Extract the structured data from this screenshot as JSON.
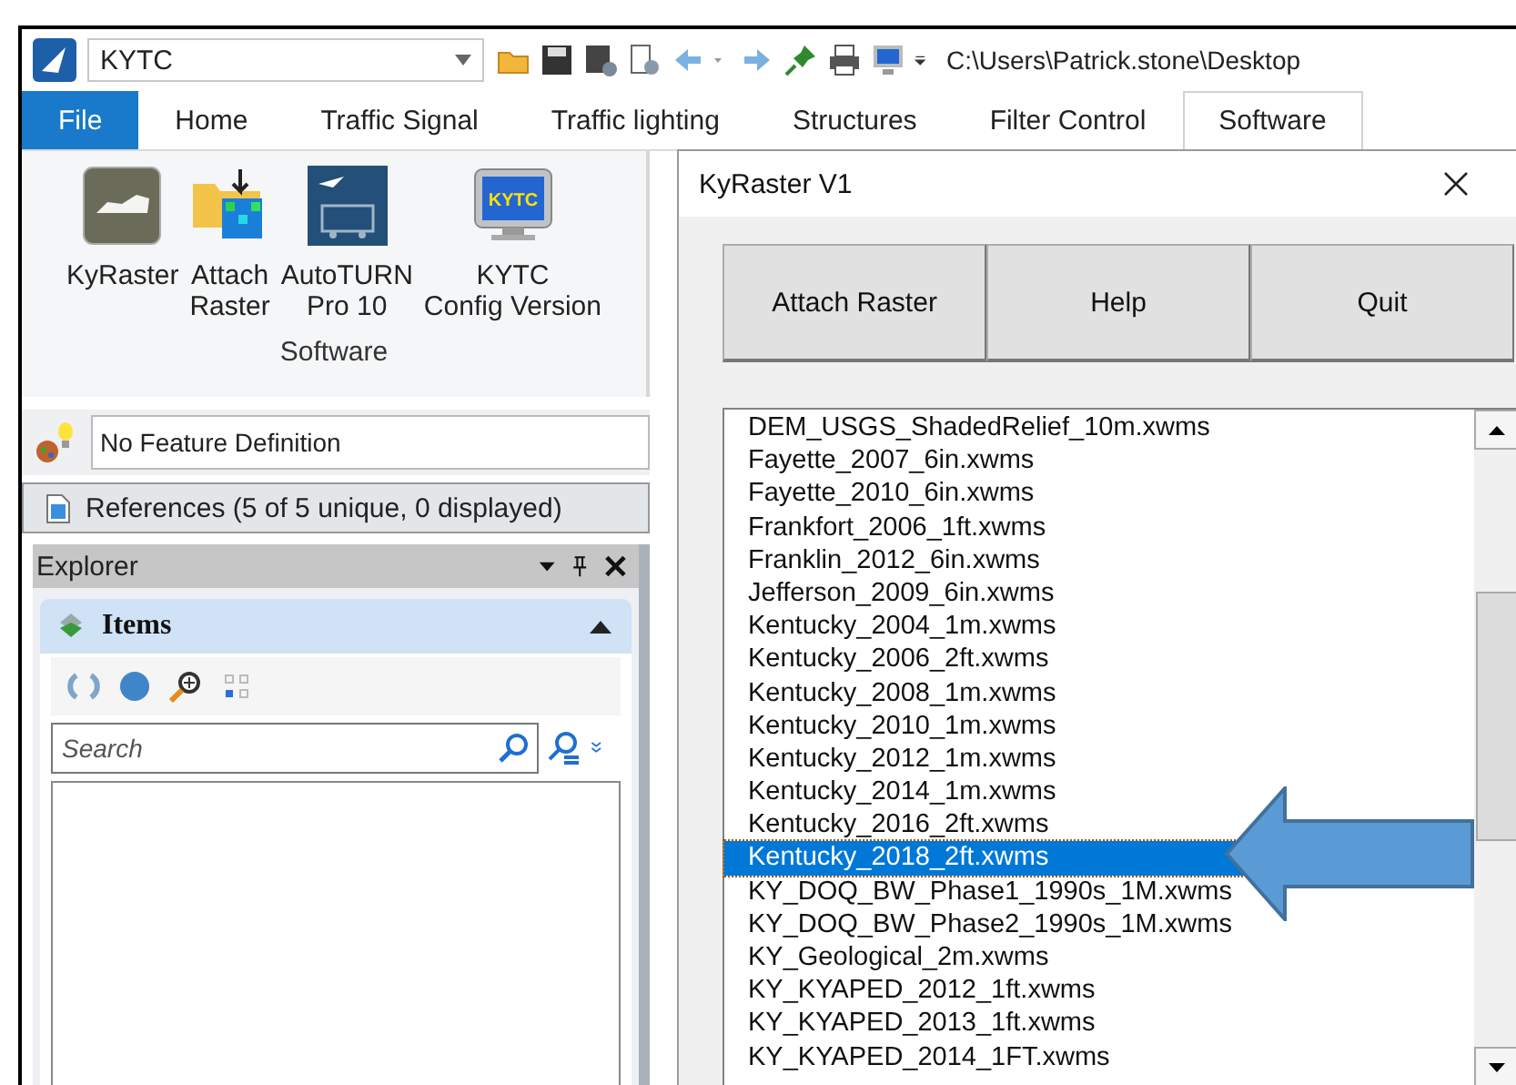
{
  "app_bar": {
    "workspace": "KYTC",
    "path": "C:\\Users\\Patrick.stone\\Desktop"
  },
  "ribbon_tabs": [
    {
      "label": "File",
      "kind": "file",
      "selected": false
    },
    {
      "label": "Home",
      "kind": "tab",
      "selected": false
    },
    {
      "label": "Traffic Signal",
      "kind": "tab",
      "selected": false
    },
    {
      "label": "Traffic lighting",
      "kind": "tab",
      "selected": false
    },
    {
      "label": "Structures",
      "kind": "tab",
      "selected": false
    },
    {
      "label": "Filter Control",
      "kind": "tab",
      "selected": false
    },
    {
      "label": "Software",
      "kind": "tab",
      "selected": true
    }
  ],
  "ribbon_group": {
    "title": "Software",
    "buttons": [
      {
        "label": "KyRaster"
      },
      {
        "label": "Attach\nRaster"
      },
      {
        "label": "AutoTURN\nPro 10"
      },
      {
        "label": "KYTC\nConfig Version",
        "icon_text": "KYTC"
      }
    ]
  },
  "feature_definition": "No Feature Definition",
  "references": "References (5 of 5 unique, 0 displayed)",
  "explorer": {
    "title": "Explorer",
    "section": {
      "title": "Items",
      "expanded": true
    },
    "search": {
      "placeholder": "Search"
    }
  },
  "dialog": {
    "title": "KyRaster V1",
    "buttons": [
      "Attach Raster",
      "Help",
      "Quit"
    ],
    "files": [
      {
        "name": "DEM_USGS_ShadedRelief_10m.xwms",
        "selected": false
      },
      {
        "name": "Fayette_2007_6in.xwms",
        "selected": false
      },
      {
        "name": "Fayette_2010_6in.xwms",
        "selected": false
      },
      {
        "name": "Frankfort_2006_1ft.xwms",
        "selected": false
      },
      {
        "name": "Franklin_2012_6in.xwms",
        "selected": false
      },
      {
        "name": "Jefferson_2009_6in.xwms",
        "selected": false
      },
      {
        "name": "Kentucky_2004_1m.xwms",
        "selected": false
      },
      {
        "name": "Kentucky_2006_2ft.xwms",
        "selected": false
      },
      {
        "name": "Kentucky_2008_1m.xwms",
        "selected": false
      },
      {
        "name": "Kentucky_2010_1m.xwms",
        "selected": false
      },
      {
        "name": "Kentucky_2012_1m.xwms",
        "selected": false
      },
      {
        "name": "Kentucky_2014_1m.xwms",
        "selected": false
      },
      {
        "name": "Kentucky_2016_2ft.xwms",
        "selected": false
      },
      {
        "name": "Kentucky_2018_2ft.xwms",
        "selected": true
      },
      {
        "name": "KY_DOQ_BW_Phase1_1990s_1M.xwms",
        "selected": false
      },
      {
        "name": "KY_DOQ_BW_Phase2_1990s_1M.xwms",
        "selected": false
      },
      {
        "name": "KY_Geological_2m.xwms",
        "selected": false
      },
      {
        "name": "KY_KYAPED_2012_1ft.xwms",
        "selected": false
      },
      {
        "name": "KY_KYAPED_2013_1ft.xwms",
        "selected": false
      },
      {
        "name": "KY_KYAPED_2014_1FT.xwms",
        "selected": false
      }
    ]
  }
}
